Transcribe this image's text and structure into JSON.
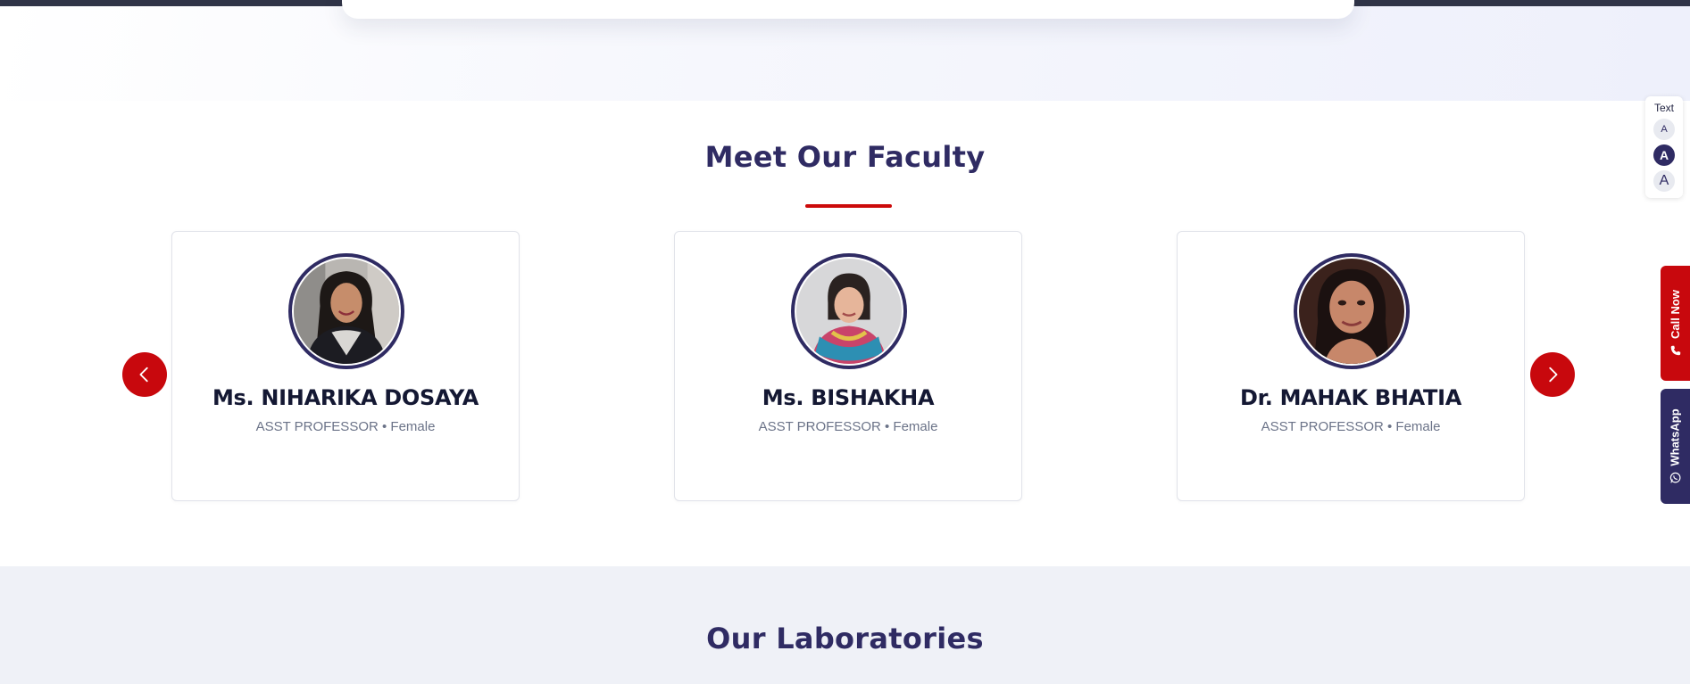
{
  "faculty": {
    "title": "Meet Our Faculty",
    "members": [
      {
        "name": "Ms. NIHARIKA DOSAYA",
        "role": "ASST PROFESSOR • Female"
      },
      {
        "name": "Ms. BISHAKHA",
        "role": "ASST PROFESSOR • Female"
      },
      {
        "name": "Dr. MAHAK BHATIA",
        "role": "ASST PROFESSOR • Female"
      }
    ]
  },
  "labs": {
    "title": "Our Laboratories"
  },
  "text_size": {
    "label": "Text",
    "small": "A",
    "medium": "A",
    "large": "A"
  },
  "side_buttons": {
    "call": "Call Now",
    "whatsapp": "WhatsApp"
  },
  "colors": {
    "primary": "#2f2b63",
    "accent": "#c8080d",
    "topbar": "#303447",
    "labs_bg": "#eff1f7"
  }
}
